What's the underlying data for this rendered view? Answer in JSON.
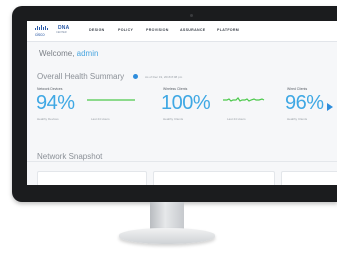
{
  "brand": {
    "logo": "cisco",
    "product": "DNA",
    "product_sub": "CENTER"
  },
  "nav": {
    "items": [
      "DESIGN",
      "POLICY",
      "PROVISION",
      "ASSURANCE",
      "PLATFORM"
    ]
  },
  "welcome": {
    "prefix": "Welcome,",
    "user": "admin"
  },
  "health": {
    "title": "Overall Health Summary",
    "as_of": "As of Dec 19, 2018 8:08 pm",
    "panels": [
      {
        "label": "Network Devices",
        "value": "94%",
        "caption": "Healthy Devices",
        "trend_caption": "Last 24 Hours"
      },
      {
        "label": "Wireless Clients",
        "value": "100%",
        "caption": "Healthy Clients",
        "trend_caption": "Last 24 Hours"
      },
      {
        "label": "Wired Clients",
        "value": "96%",
        "caption": "Healthy Clients"
      }
    ]
  },
  "snapshot": {
    "title": "Network Snapshot"
  },
  "colors": {
    "accent": "#3fa8e4",
    "trend": "#4cc94c",
    "status_dot": "#2f8ddc"
  },
  "icons": [
    "cisco-logo-icon",
    "status-dot-icon",
    "sparkline-icon",
    "next-arrow-icon"
  ]
}
